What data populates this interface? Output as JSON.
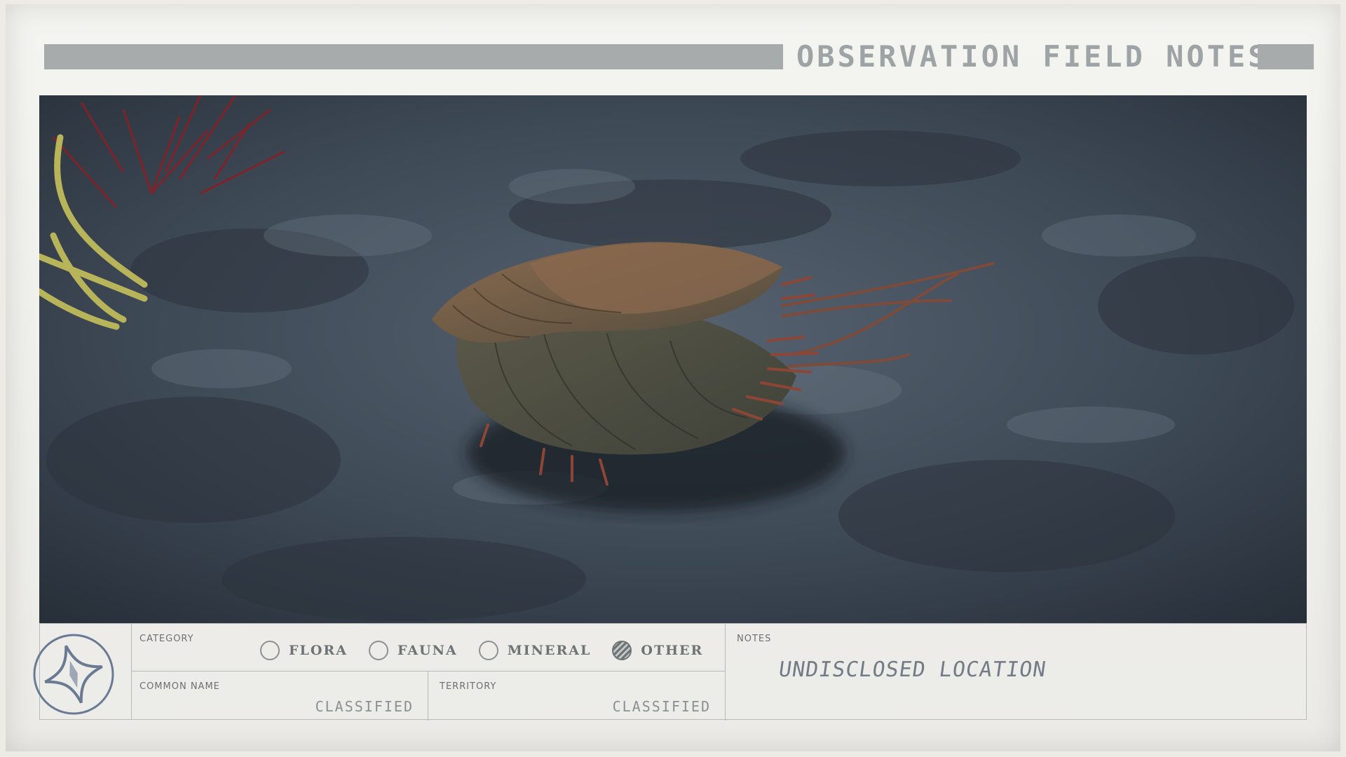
{
  "header": {
    "title": "OBSERVATION FIELD NOTES"
  },
  "photo": {
    "subject_icon": "creature-photo"
  },
  "panel": {
    "logo_icon": "compass-star-icon",
    "category": {
      "label": "CATEGORY",
      "options": [
        {
          "label": "FLORA",
          "selected": false
        },
        {
          "label": "FAUNA",
          "selected": false
        },
        {
          "label": "MINERAL",
          "selected": false
        },
        {
          "label": "OTHER",
          "selected": true
        }
      ]
    },
    "common_name": {
      "label": "COMMON NAME",
      "value": "CLASSIFIED"
    },
    "territory": {
      "label": "TERRITORY",
      "value": "CLASSIFIED"
    },
    "notes": {
      "label": "NOTES",
      "value": "UNDISCLOSED LOCATION"
    }
  },
  "colors": {
    "paper": "#eeeeea",
    "bar": "#a7abac",
    "title": "#9ea3a5",
    "ink": "#6e7375",
    "handwriting": "#727b86"
  }
}
